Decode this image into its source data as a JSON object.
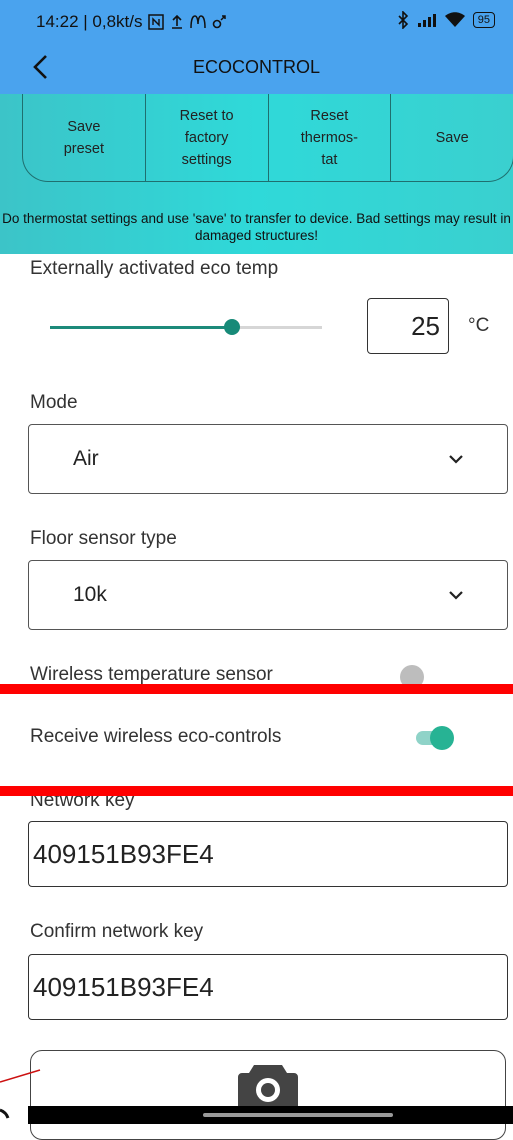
{
  "status_bar": {
    "left_text": "14:22 | 0,8kt/s",
    "left_icons": [
      "nfc-icon",
      "upload-icon",
      "mcdonalds-icon",
      "motion-icon"
    ],
    "right_icons": [
      "bluetooth-icon",
      "signal-icon",
      "wifi-icon"
    ],
    "battery": "95"
  },
  "app_bar": {
    "title": "ECOCONTROL"
  },
  "actions": {
    "save_preset": "Save\npreset",
    "reset_factory": "Reset to\nfactory\nsettings",
    "reset_thermostat": "Reset\nthermos-\ntat",
    "save": "Save"
  },
  "warning": "Do thermostat settings and use 'save' to transfer to device. Bad settings may result in damaged structures!",
  "eco_temp": {
    "label": "Externally activated eco temp",
    "value": "25",
    "unit": "°C",
    "slider_fraction": 0.67
  },
  "mode": {
    "label": "Mode",
    "selected": "Air"
  },
  "floor_sensor": {
    "label": "Floor sensor type",
    "selected": "10k"
  },
  "wireless_temp_sensor": {
    "label": "Wireless temperature sensor",
    "enabled": false
  },
  "wireless_eco_controls": {
    "label": "Receive wireless eco-controls",
    "enabled": true
  },
  "network_key": {
    "label": "Network key",
    "value": "409151B93FE4"
  },
  "confirm_network_key": {
    "label": "Confirm network key",
    "value": "409151B93FE4"
  },
  "colors": {
    "header": "#4aa3ee",
    "banner": "#2fd9d9",
    "accent": "#178a78",
    "highlight": "#ff0000"
  }
}
